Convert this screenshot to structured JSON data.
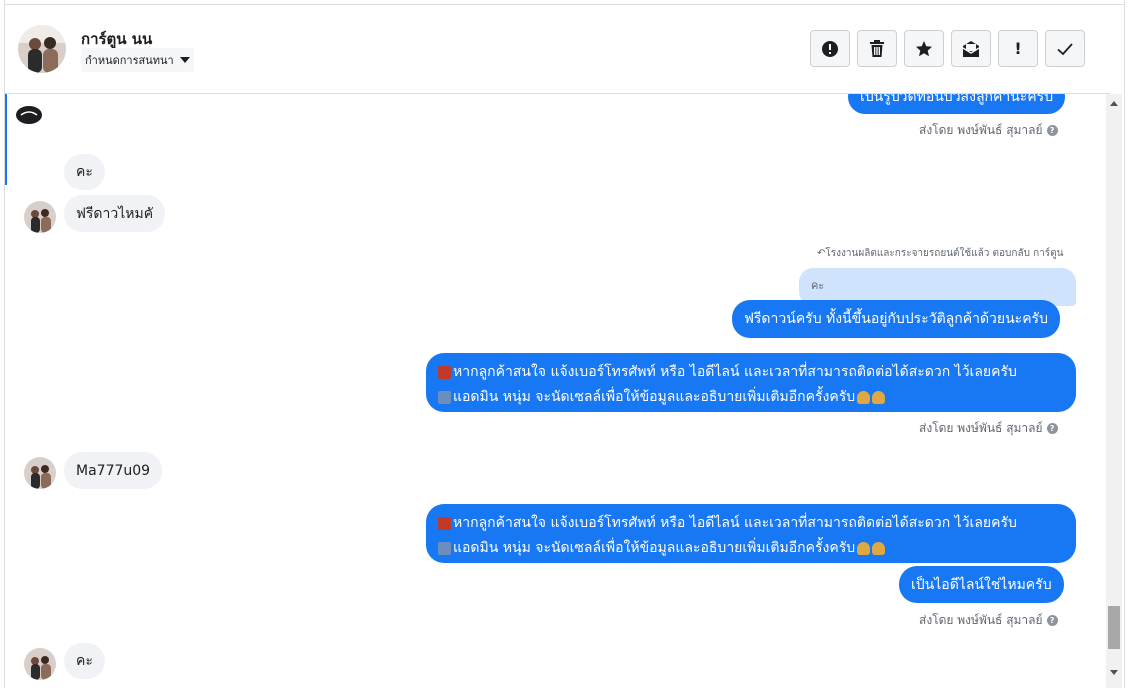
{
  "header": {
    "contact_name": "การ์ตูน นน",
    "label_select": "กำหนดการสนทนา",
    "actions": [
      "mark-spam",
      "delete",
      "star",
      "move-to-inbox",
      "mark-important",
      "mark-done"
    ]
  },
  "thread": {
    "top_partial_out": "เป็นรูปวิดีทอนบิวสิงลูกค้านะครับ",
    "sent_by_1": "ส่งโดย พงษ์พันธ์ สุมาลย์",
    "in_1": "คะ",
    "in_2": "ฟรีดาวไหมคั",
    "reply_meta": "โรงงานผลิตและกระจายรถยนต์ใช้แล้ว ตอบกลับ การ์ตูน",
    "quoted_text": "คะ",
    "out_reply": "ฟรีดาวน์ครับ ทั้งนี้ขึ้นอยู่กับประวัติลูกค้าด้วยนะครับ",
    "out_long_1a": "หากลูกค้าสนใจ แจ้งเบอร์โทรศัพท์ หรือ ไอดีไลน์ และเวลาที่สามารถติดต่อได้สะดวก ไว้เลยครับ",
    "out_long_1b": "แอดมิน หนุ่ม จะนัดเซลล์เพื่อให้ข้อมูลและอธิบายเพิ่มเติมอีกครั้งครับ",
    "sent_by_2": "ส่งโดย พงษ์พันธ์ สุมาลย์",
    "in_3": "Ma777u09",
    "out_long_2a": "หากลูกค้าสนใจ แจ้งเบอร์โทรศัพท์ หรือ ไอดีไลน์ และเวลาที่สามารถติดต่อได้สะดวก ไว้เลยครับ",
    "out_long_2b": "แอดมิน หนุ่ม จะนัดเซลล์เพื่อให้ข้อมูลและอธิบายเพิ่มเติมอีกครั้งครับ",
    "out_short": "เป็นไอดีไลน์ใช่ไหมครับ",
    "sent_by_3": "ส่งโดย พงษ์พันธ์ สุมาลย์",
    "in_4": "คะ"
  },
  "colors": {
    "outgoing_bubble": "#1877f2",
    "incoming_bubble": "#f0f2f5",
    "quoted_bubble": "#cfe3fd"
  }
}
